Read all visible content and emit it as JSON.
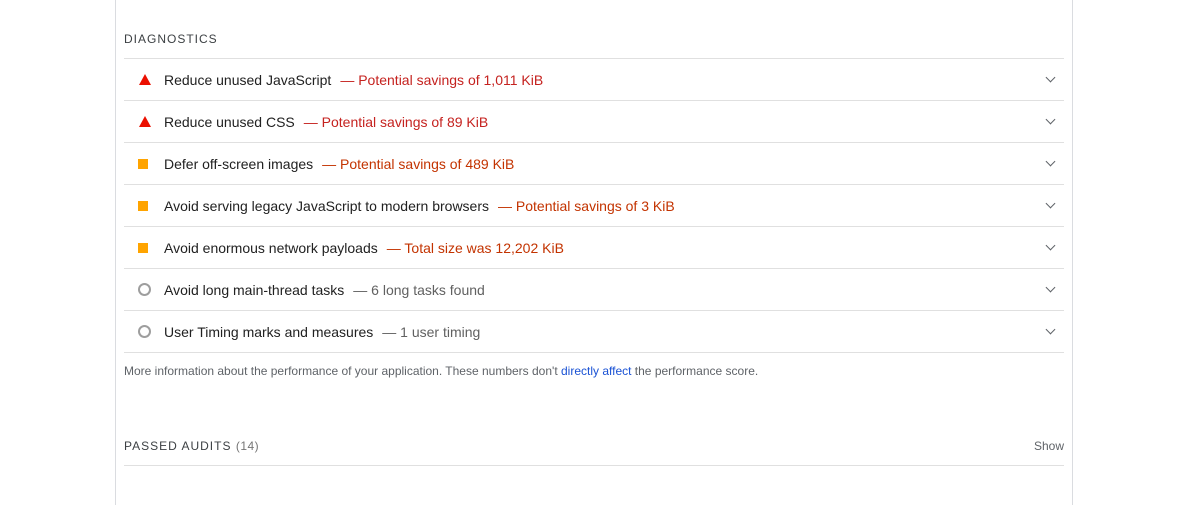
{
  "diagnostics": {
    "title": "DIAGNOSTICS",
    "audits": [
      {
        "icon": "fail-triangle-icon",
        "title": "Reduce unused JavaScript",
        "display": "— Potential savings of 1,011 KiB",
        "rating": "fail"
      },
      {
        "icon": "fail-triangle-icon",
        "title": "Reduce unused CSS",
        "display": "— Potential savings of 89 KiB",
        "rating": "fail"
      },
      {
        "icon": "average-square-icon",
        "title": "Defer off-screen images",
        "display": "— Potential savings of 489 KiB",
        "rating": "average"
      },
      {
        "icon": "average-square-icon",
        "title": "Avoid serving legacy JavaScript to modern browsers",
        "display": "— Potential savings of 3 KiB",
        "rating": "average"
      },
      {
        "icon": "average-square-icon",
        "title": "Avoid enormous network payloads",
        "display": "— Total size was 12,202 KiB",
        "rating": "average"
      },
      {
        "icon": "info-circle-icon",
        "title": "Avoid long main-thread tasks",
        "display": "— 6 long tasks found",
        "rating": "informative"
      },
      {
        "icon": "info-circle-icon",
        "title": "User Timing marks and measures",
        "display": "— 1 user timing",
        "rating": "informative"
      }
    ],
    "note_before": "More information about the performance of your application. These numbers don't ",
    "note_link": "directly affect",
    "note_after": " the performance score."
  },
  "passed": {
    "label": "PASSED AUDITS",
    "count": "(14)",
    "toggle": "Show"
  },
  "colors": {
    "fail": "#eb0f00",
    "average": "#ffa400",
    "informative": "#9e9e9e",
    "link": "#1a52d4"
  }
}
